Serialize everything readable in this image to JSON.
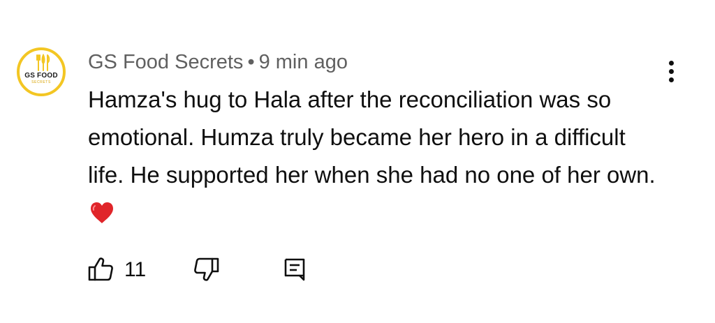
{
  "comment": {
    "author": "GS Food Secrets",
    "separator": "•",
    "time_ago": "9 min ago",
    "text": "Hamza's hug to Hala after the reconciliation was so emotional. Humza truly became her hero in a difficult life. He supported her when she had no one of her own.",
    "emoji": "heart-emoji",
    "avatar": {
      "logo_text": "GS FOOD",
      "logo_subtext": "SECRETS",
      "brand_color": "#f3c623"
    },
    "actions": {
      "like_count": "11",
      "like_icon": "thumbs-up-icon",
      "dislike_icon": "thumbs-down-icon",
      "reply_icon": "reply-comment-icon",
      "more_icon": "more-vertical-icon"
    }
  },
  "colors": {
    "meta_text": "#606060",
    "body_text": "#0f0f0f",
    "heart": "#e0252a"
  }
}
